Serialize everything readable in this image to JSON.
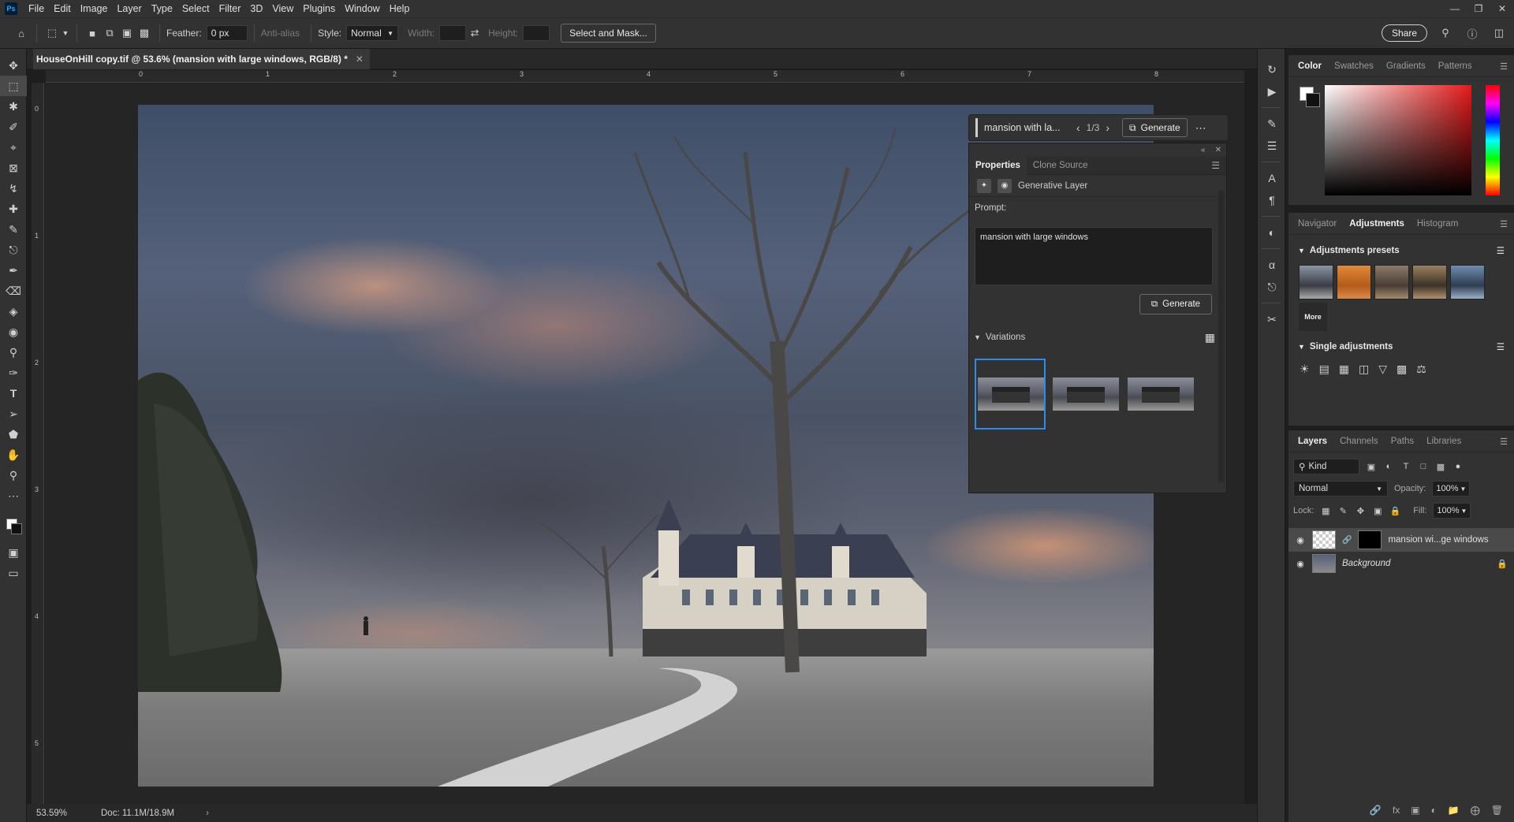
{
  "menubar": {
    "logo": "Ps",
    "items": [
      "File",
      "Edit",
      "Image",
      "Layer",
      "Type",
      "Select",
      "Filter",
      "3D",
      "View",
      "Plugins",
      "Window",
      "Help"
    ]
  },
  "options": {
    "feather_label": "Feather:",
    "feather_value": "0 px",
    "anti_alias": "Anti-alias",
    "style_label": "Style:",
    "style_value": "Normal",
    "width_label": "Width:",
    "height_label": "Height:",
    "select_mask": "Select and Mask...",
    "share": "Share"
  },
  "document": {
    "tab_title": "HouseOnHill copy.tif @ 53.6% (mansion with large windows, RGB/8) *",
    "zoom": "53.59%",
    "doc_size": "Doc: 11.1M/18.9M"
  },
  "rulers": {
    "h": [
      "0",
      "1",
      "2",
      "3",
      "4",
      "5",
      "6",
      "7",
      "8"
    ],
    "v": [
      "0",
      "1",
      "2",
      "3",
      "4",
      "5"
    ]
  },
  "genbar": {
    "prompt_preview": "mansion with la...",
    "counter": "1/3",
    "generate": "Generate"
  },
  "properties": {
    "tabs": [
      "Properties",
      "Clone Source"
    ],
    "layer_type": "Generative Layer",
    "prompt_label": "Prompt:",
    "prompt_text": "mansion with large windows",
    "generate": "Generate",
    "variations_label": "Variations",
    "variation_count": 3
  },
  "color_panel": {
    "tabs": [
      "Color",
      "Swatches",
      "Gradients",
      "Patterns"
    ],
    "foreground": "#ffffff",
    "background": "#111111"
  },
  "adjustments": {
    "tabs": [
      "Navigator",
      "Adjustments",
      "Histogram"
    ],
    "presets_label": "Adjustments presets",
    "more_label": "More",
    "single_label": "Single adjustments"
  },
  "layers": {
    "tabs": [
      "Layers",
      "Channels",
      "Paths",
      "Libraries"
    ],
    "kind": "Kind",
    "blend_mode": "Normal",
    "opacity_label": "Opacity:",
    "opacity_value": "100%",
    "lock_label": "Lock:",
    "fill_label": "Fill:",
    "fill_value": "100%",
    "items": [
      {
        "name": "mansion wi...ge windows",
        "selected": true
      },
      {
        "name": "Background",
        "selected": false
      }
    ]
  },
  "colors": {
    "accent": "#2d8ceb",
    "panel": "#323232",
    "canvas": "#252525"
  }
}
